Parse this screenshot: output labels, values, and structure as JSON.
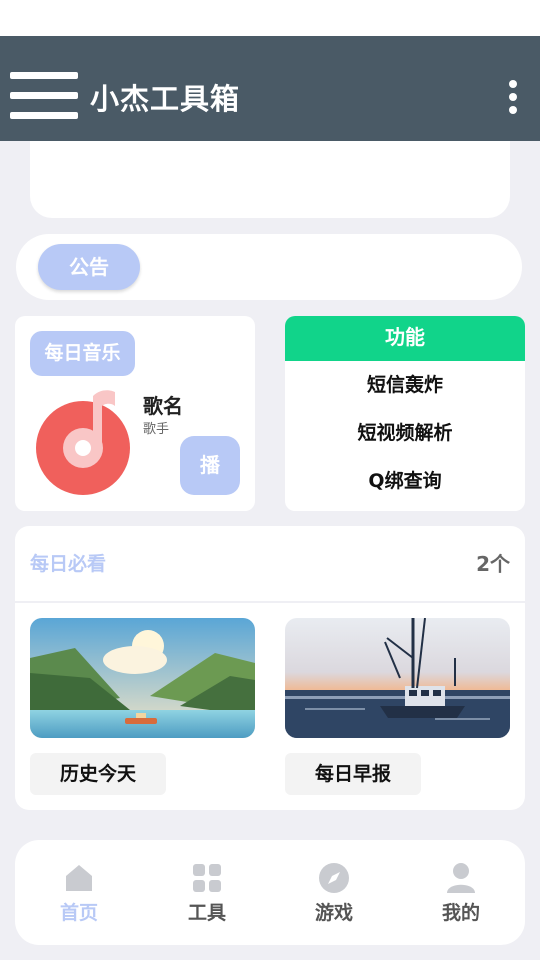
{
  "app": {
    "title": "小杰工具箱"
  },
  "notice": {
    "label": "公告"
  },
  "music": {
    "tag": "每日音乐",
    "song": "歌名",
    "singer": "歌手",
    "play_label": "播"
  },
  "functions": {
    "header": "功能",
    "items": [
      "短信轰炸",
      "短视频解析",
      "Q绑查询"
    ]
  },
  "daily": {
    "title": "每日必看",
    "count": "2个",
    "items": [
      {
        "label": "历史今天",
        "image": "lake-mountain-landscape"
      },
      {
        "label": "每日早报",
        "image": "fishing-boat-sunset"
      }
    ]
  },
  "tabs": [
    {
      "label": "首页",
      "icon": "home-icon",
      "active": true
    },
    {
      "label": "工具",
      "icon": "grid-icon",
      "active": false
    },
    {
      "label": "游戏",
      "icon": "compass-icon",
      "active": false
    },
    {
      "label": "我的",
      "icon": "user-icon",
      "active": false
    }
  ],
  "colors": {
    "appbar": "#4a5a66",
    "accent": "#b8c9f6",
    "function_header": "#11d48a",
    "disc": "#f0605c"
  }
}
